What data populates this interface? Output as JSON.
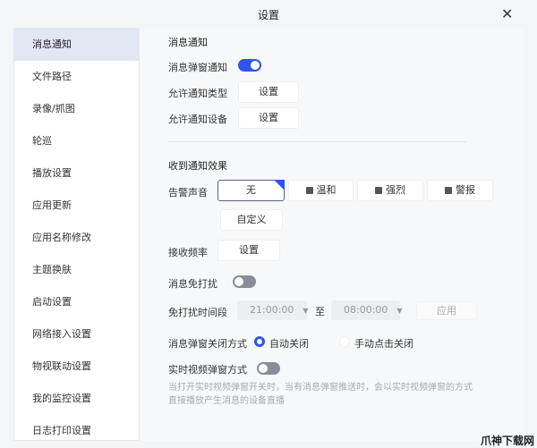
{
  "window": {
    "title": "设置",
    "close_icon": "close-icon"
  },
  "sidebar": {
    "items": [
      {
        "label": "消息通知",
        "active": true
      },
      {
        "label": "文件路径"
      },
      {
        "label": "录像/抓图"
      },
      {
        "label": "轮巡"
      },
      {
        "label": "播放设置"
      },
      {
        "label": "应用更新"
      },
      {
        "label": "应用名称修改"
      },
      {
        "label": "主题换肤"
      },
      {
        "label": "启动设置"
      },
      {
        "label": "网络接入设置"
      },
      {
        "label": "物视联动设置"
      },
      {
        "label": "我的监控设置"
      },
      {
        "label": "日志打印设置"
      }
    ]
  },
  "notify": {
    "section": "消息通知",
    "popup_label": "消息弹窗通知",
    "popup_on": true,
    "type_label": "允许通知类型",
    "type_btn": "设置",
    "device_label": "允许通知设备",
    "device_btn": "设置"
  },
  "effect": {
    "section": "收到通知效果",
    "sound_label": "告警声音",
    "sounds": [
      "无",
      "温和",
      "强烈",
      "警报"
    ],
    "selected_sound": "无",
    "custom_btn": "自定义",
    "freq_label": "接收频率",
    "freq_btn": "设置"
  },
  "dnd": {
    "label": "消息免打扰",
    "on": false,
    "period_label": "免打扰时间段",
    "start": "21:00:00",
    "to": "至",
    "end": "08:00:00",
    "apply_btn": "应用"
  },
  "close_mode": {
    "label": "消息弹窗关闭方式",
    "options": [
      "自动关闭",
      "手动点击关闭"
    ],
    "selected": "自动关闭"
  },
  "realtime": {
    "label": "实时视频弹窗方式",
    "on": false,
    "desc1": "当打开实时视频弹窗开关时，当有消息弹窗推送时，会以实时视频弹窗的方式",
    "desc2": "直接播放产生消息的设备直播"
  },
  "watermark": "爪神下载网"
}
